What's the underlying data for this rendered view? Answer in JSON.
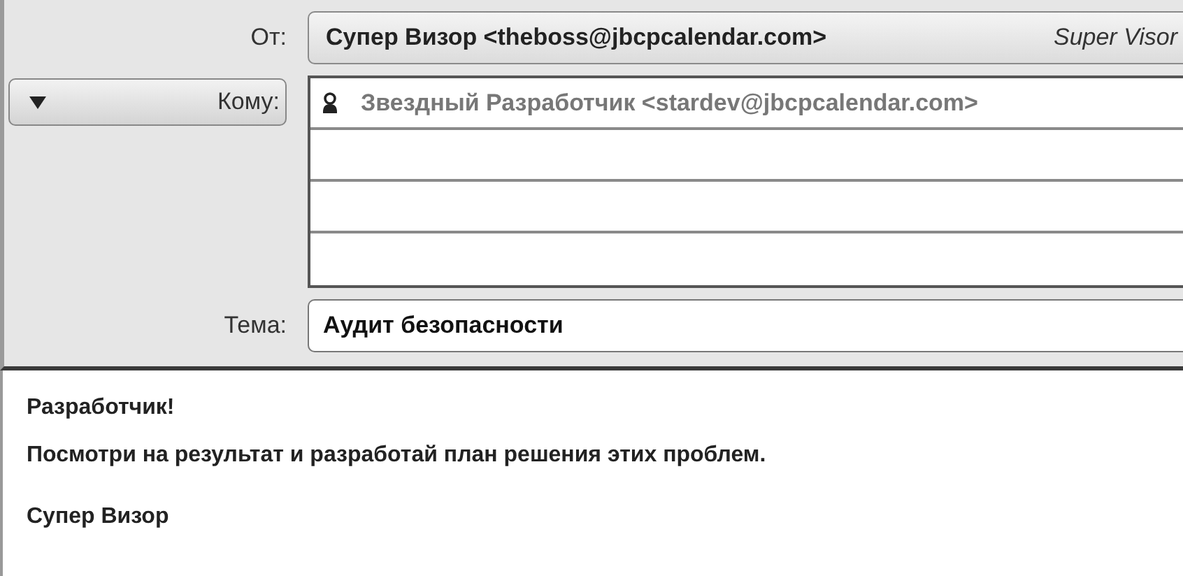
{
  "from": {
    "label": "От:",
    "value": "Супер Визор <theboss@jbcpcalendar.com>",
    "account": "Super Visor"
  },
  "to": {
    "label": "Кому:",
    "recipients": [
      {
        "address": "Звездный Разработчик <stardev@jbcpcalendar.com>"
      }
    ]
  },
  "subject": {
    "label": "Тема:",
    "value": "Аудит безопасности"
  },
  "body": [
    "Разработчик!",
    "Посмотри на результат и разработай план решения этих проблем.",
    "Супер Визор"
  ]
}
